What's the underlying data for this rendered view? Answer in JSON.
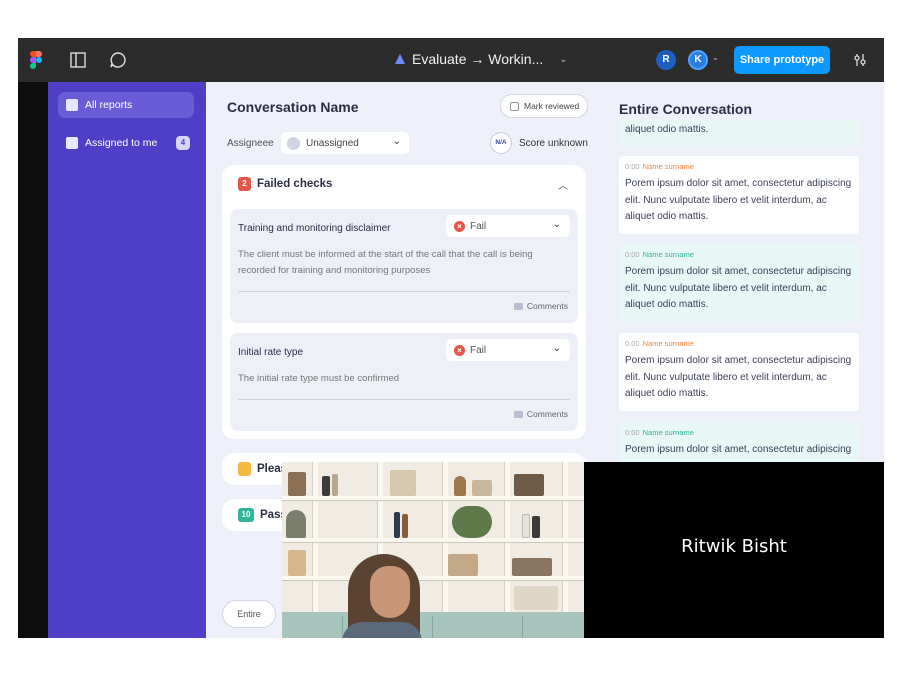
{
  "toolbar": {
    "title": "Evaluate → Workin...",
    "caret": "⌄",
    "avatars": [
      "R",
      "K"
    ],
    "share_label": "Share prototype"
  },
  "sidebar": {
    "items": [
      {
        "label": "All reports",
        "active": true
      },
      {
        "label": "Assigned to me",
        "badge": "4"
      }
    ]
  },
  "main": {
    "title": "Conversation Name",
    "mark_reviewed": "Mark reviewed",
    "assignee_label": "Assigneee",
    "assignee_value": "Unassigned",
    "score_badge": "N/A",
    "score_text": "Score unknown",
    "failed": {
      "count": "2",
      "title": "Failed checks",
      "checks": [
        {
          "name": "Training and monitoring disclaimer",
          "status": "Fail",
          "description": "The client must be informed at the start of the call that the call is being recorded for training and monitoring purposes",
          "comments": "Comments"
        },
        {
          "name": "Initial rate type",
          "status": "Fail",
          "description": "The initial rate type must be confirmed",
          "comments": "Comments"
        }
      ]
    },
    "please_label": "Pleas",
    "passed": {
      "count": "10",
      "label": "Pass"
    },
    "entire_pill": "Entire"
  },
  "conversation": {
    "title": "Entire Conversation",
    "top_snippet": "aliquet odio mattis.",
    "messages": [
      {
        "time": "0:00",
        "name": "Name surname",
        "body": "Porem ipsum dolor sit amet, consectetur adipiscing elit. Nunc vulputate libero et velit interdum, ac aliquet odio mattis."
      },
      {
        "time": "0:00",
        "name": "Name surname",
        "body": "Porem ipsum dolor sit amet, consectetur adipiscing elit. Nunc vulputate libero et velit interdum, ac aliquet odio mattis."
      },
      {
        "time": "0:00",
        "name": "Name surname",
        "body": "Porem ipsum dolor sit amet, consectetur adipiscing elit. Nunc vulputate libero et velit interdum, ac aliquet odio mattis."
      },
      {
        "time": "0:00",
        "name": "Name surname",
        "body": "Porem ipsum dolor sit amet, consectetur adipiscing"
      }
    ]
  },
  "video_call": {
    "participant_name": "Ritwik Bisht"
  },
  "colors": {
    "sidebar": "#4f3fc7",
    "share_button": "#0d99ff",
    "fail": "#e2574c",
    "failed_badge": "#e2574c",
    "pending_badge": "#f5b942",
    "passed_badge": "#2fb59a",
    "speaker_agent": "#f0863c",
    "speaker_client": "#2fb59a"
  }
}
